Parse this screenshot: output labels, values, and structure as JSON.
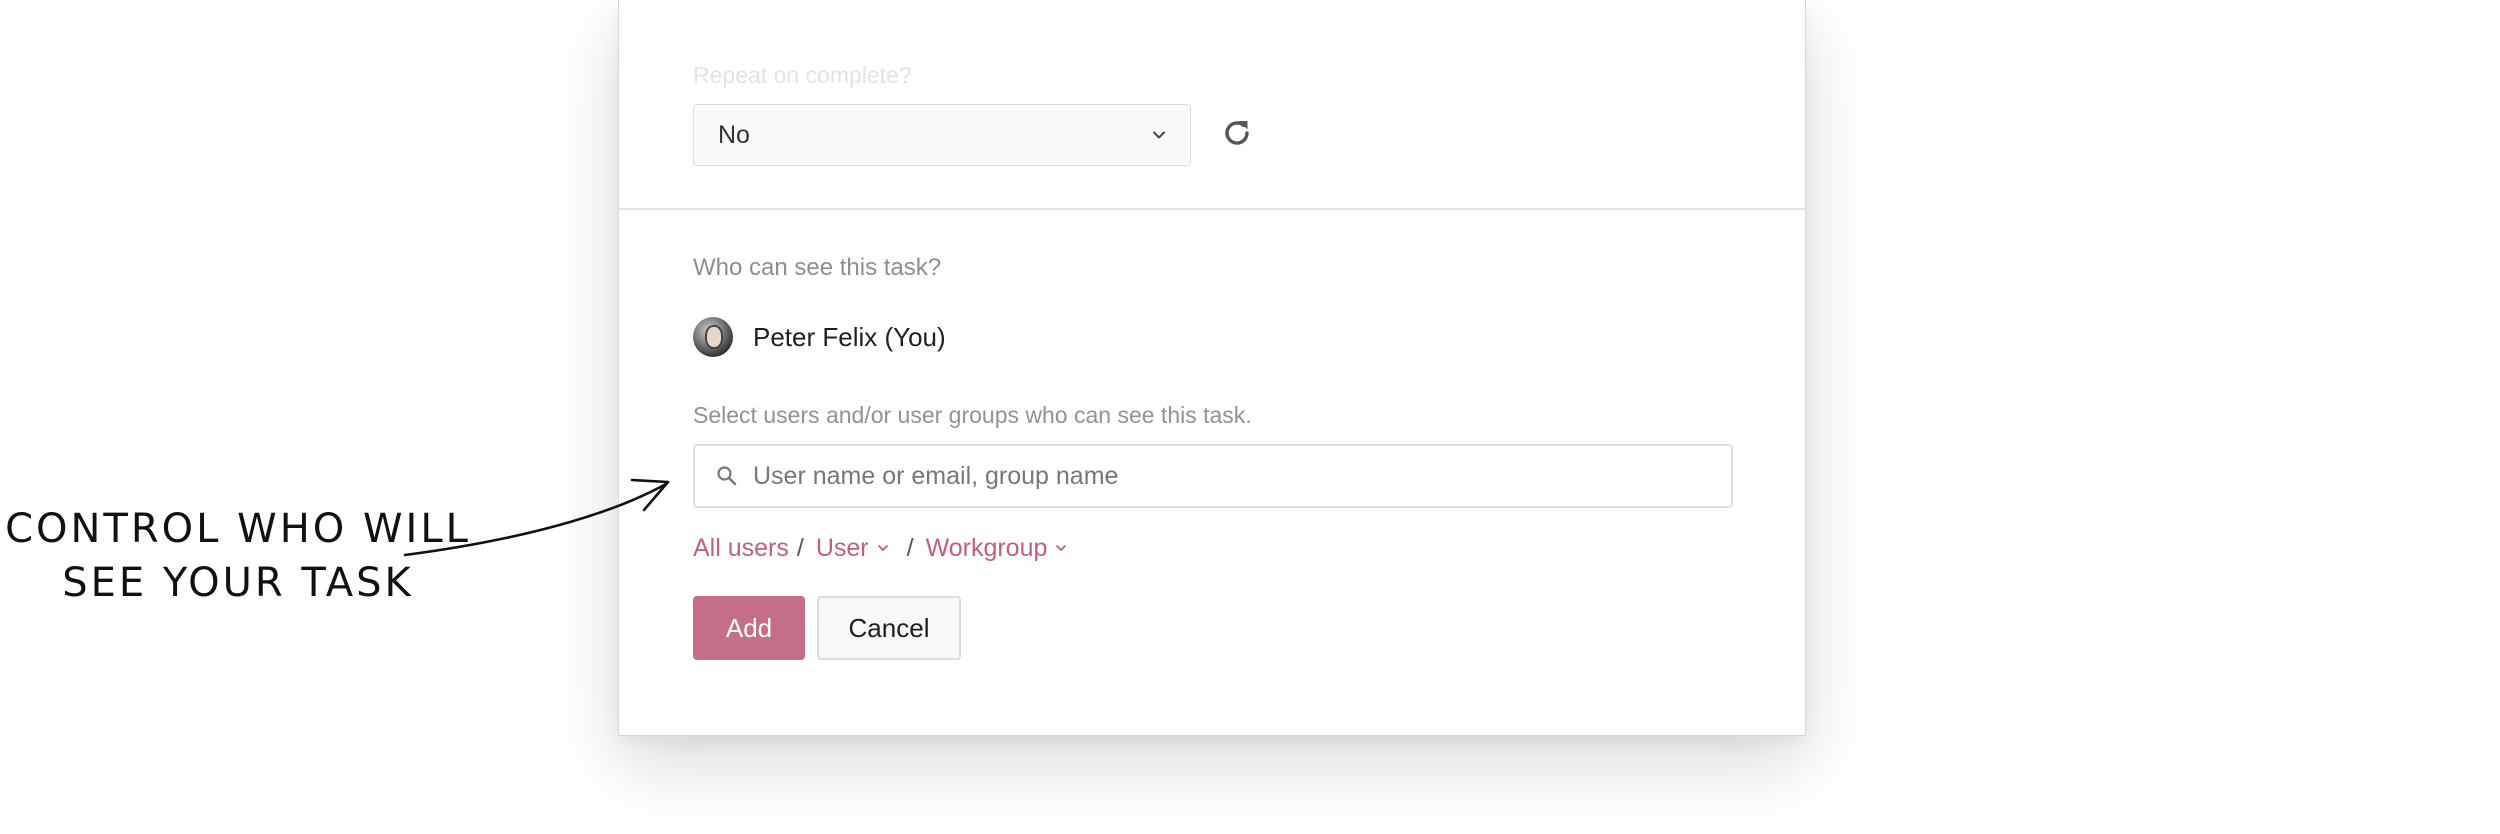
{
  "repeat": {
    "label": "Repeat on complete?",
    "value": "No"
  },
  "visibility": {
    "question": "Who can see this task?",
    "owner": "Peter Felix (You)",
    "hint": "Select users and/or user groups who can see this task.",
    "search_placeholder": "User name or email, group name",
    "filters": {
      "all_users": "All users",
      "user": "User",
      "workgroup": "Workgroup",
      "separator": "/"
    },
    "add_label": "Add",
    "cancel_label": "Cancel"
  },
  "annotation": {
    "line1": "CONTROL WHO WILL",
    "line2": "SEE YOUR TASK"
  },
  "colors": {
    "accent": "#c0607e",
    "button_primary": "#c56f86"
  },
  "icons": [
    "chevron-down-icon",
    "refresh-icon",
    "search-icon",
    "avatar",
    "arrow-icon"
  ]
}
